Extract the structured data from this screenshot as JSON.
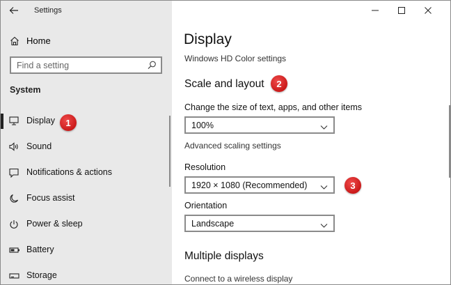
{
  "window": {
    "title": "Settings"
  },
  "sidebar": {
    "home_label": "Home",
    "search_placeholder": "Find a setting",
    "section_label": "System",
    "items": [
      {
        "label": "Display",
        "icon": "monitor-icon",
        "selected": true
      },
      {
        "label": "Sound",
        "icon": "speaker-icon"
      },
      {
        "label": "Notifications & actions",
        "icon": "notification-icon"
      },
      {
        "label": "Focus assist",
        "icon": "moon-icon"
      },
      {
        "label": "Power & sleep",
        "icon": "power-icon"
      },
      {
        "label": "Battery",
        "icon": "battery-icon"
      },
      {
        "label": "Storage",
        "icon": "storage-icon"
      }
    ]
  },
  "main": {
    "title": "Display",
    "hd_color_link": "Windows HD Color settings",
    "scale_section": "Scale and layout",
    "scale_label": "Change the size of text, apps, and other items",
    "scale_value": "100%",
    "advanced_scaling_link": "Advanced scaling settings",
    "resolution_label": "Resolution",
    "resolution_value": "1920 × 1080 (Recommended)",
    "orientation_label": "Orientation",
    "orientation_value": "Landscape",
    "multiple_displays_section": "Multiple displays",
    "wireless_link": "Connect to a wireless display"
  },
  "badges": {
    "one": "1",
    "two": "2",
    "three": "3"
  },
  "colors": {
    "sidebar_bg": "#e9e9e9",
    "badge_red": "#d42020"
  }
}
